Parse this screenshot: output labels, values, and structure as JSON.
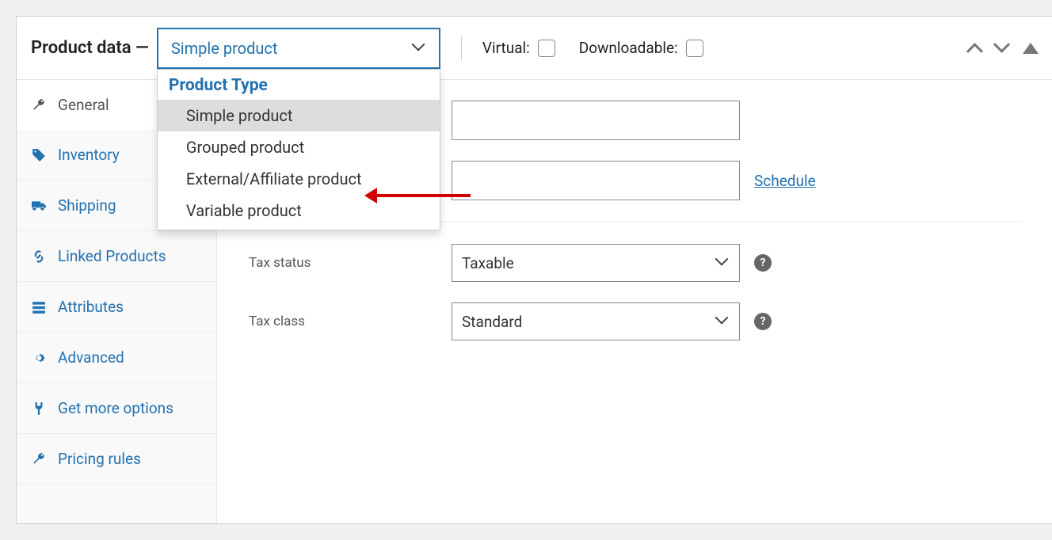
{
  "header": {
    "title": "Product data —",
    "select_value": "Simple product",
    "dropdown_heading": "Product Type",
    "dropdown_items": [
      "Simple product",
      "Grouped product",
      "External/Affiliate product",
      "Variable product"
    ],
    "virtual_label": "Virtual:",
    "downloadable_label": "Downloadable:"
  },
  "tabs": [
    {
      "label": "General"
    },
    {
      "label": "Inventory"
    },
    {
      "label": "Shipping"
    },
    {
      "label": "Linked Products"
    },
    {
      "label": "Attributes"
    },
    {
      "label": "Advanced"
    },
    {
      "label": "Get more options"
    },
    {
      "label": "Pricing rules"
    }
  ],
  "content": {
    "schedule_link": "Schedule",
    "tax_status_label": "Tax status",
    "tax_status_value": "Taxable",
    "tax_class_label": "Tax class",
    "tax_class_value": "Standard"
  }
}
